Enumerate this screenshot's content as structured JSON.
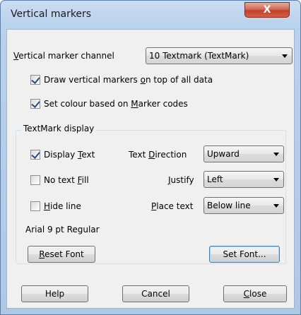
{
  "window": {
    "title": "Vertical markers",
    "close_glyph": "X"
  },
  "channel": {
    "label_pre": "",
    "label_mnemonic": "V",
    "label_post": "ertical marker channel",
    "value": "10 Textmark (TextMark)"
  },
  "draw_on_top": {
    "pre": "Draw vertical markers ",
    "mnemonic": "o",
    "post": "n top of all data",
    "checked": true
  },
  "colour_codes": {
    "pre": "Set colour based on ",
    "mnemonic": "M",
    "post": "arker codes",
    "checked": true
  },
  "textmark_group": {
    "title": "TextMark display"
  },
  "display_text": {
    "pre": "Display ",
    "mnemonic": "T",
    "post": "ext",
    "checked": true
  },
  "no_text_fill": {
    "pre": "No text ",
    "mnemonic": "F",
    "post": "ill",
    "checked": false
  },
  "hide_line": {
    "pre": "",
    "mnemonic": "H",
    "post": "ide line",
    "checked": false
  },
  "text_direction": {
    "pre": "Text ",
    "mnemonic": "D",
    "post": "irection",
    "value": "Upward"
  },
  "justify": {
    "pre": "",
    "mnemonic": "J",
    "post": "ustify",
    "value": "Left"
  },
  "place_text": {
    "pre": "",
    "mnemonic": "P",
    "post": "lace text",
    "value": "Below line"
  },
  "font_info": "Arial 9 pt  Regular",
  "reset_font": {
    "pre": "",
    "mnemonic": "R",
    "post": "eset Font"
  },
  "set_font": {
    "label": "Set Font..."
  },
  "buttons": {
    "help": "Help",
    "cancel": "Cancel",
    "close": {
      "pre": "",
      "mnemonic": "C",
      "post": "lose"
    }
  }
}
